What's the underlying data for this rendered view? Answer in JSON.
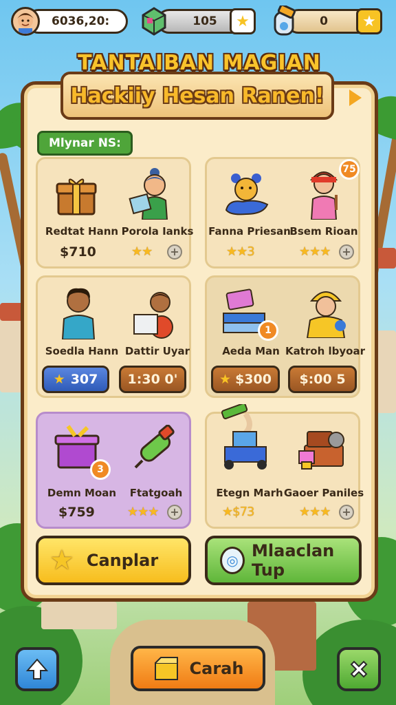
{
  "hud": {
    "coins": "6036,20:",
    "gems": "105",
    "tokens": "0"
  },
  "title": {
    "line1": "TANTAIBAN MAGIAN",
    "line2": "Hackiiy Hesan Ranen!"
  },
  "tag_label": "Mlynar NS:",
  "cards": [
    {
      "items": [
        {
          "name": "Redtat Hann",
          "price": "$710"
        },
        {
          "name": "Porola Ianks",
          "stars": "★★"
        }
      ]
    },
    {
      "badge": "75",
      "items": [
        {
          "name": "Fanna Priesan",
          "stars": "★★3"
        },
        {
          "name": "Bsem Rioan",
          "stars": "★★★"
        }
      ]
    },
    {
      "items": [
        {
          "name": "Soedla Hann",
          "button": "307"
        },
        {
          "name": "Dattir Uyar",
          "button": "1:30 0'"
        }
      ]
    },
    {
      "badge": "1",
      "items": [
        {
          "name": "Aeda Man",
          "button": "$300"
        },
        {
          "name": "Katroh lbyoar",
          "button": "$:00 5"
        }
      ]
    },
    {
      "badge": "3",
      "items": [
        {
          "name": "Demn Moan",
          "price": "$759"
        },
        {
          "name": "Ftatgoah",
          "stars": "★★★"
        }
      ]
    },
    {
      "items": [
        {
          "name": "Etegn Marh",
          "stars": "★$73"
        },
        {
          "name": "Gaoer Paniles",
          "stars": "★★★"
        }
      ]
    }
  ],
  "buttons": {
    "yellow": "Canplar",
    "green": "Mlaaclan Tup",
    "bottom_center": "Carah"
  }
}
